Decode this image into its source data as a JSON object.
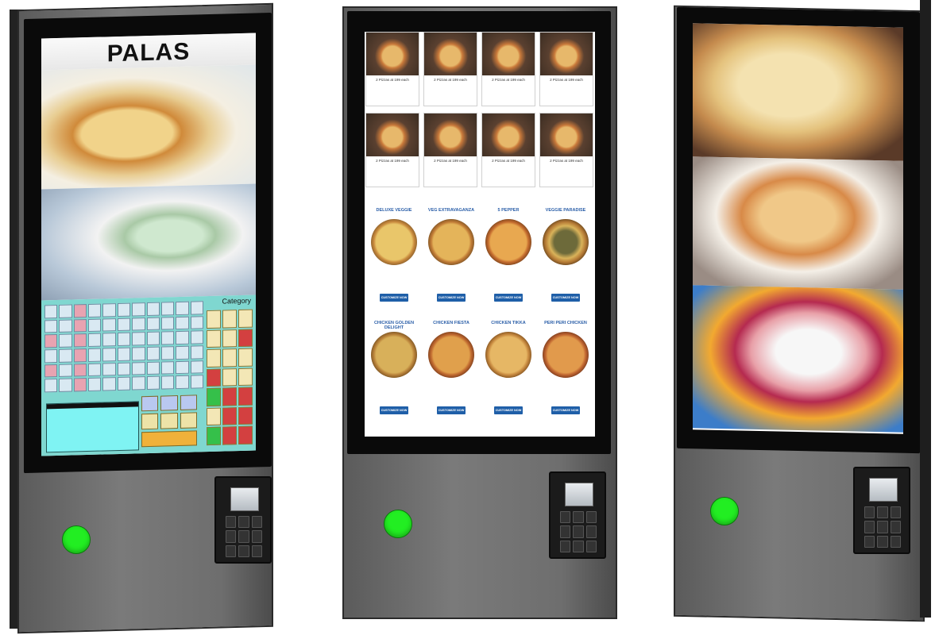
{
  "kiosks": [
    {
      "screen_title": "PALAS",
      "pos": {
        "category_label": "Category"
      }
    },
    {
      "deals": [
        {
          "line1": "2 Pizzas at 199 each"
        },
        {
          "line1": "2 Pizzas at 199 each"
        },
        {
          "line1": "2 Pizzas at 199 each"
        },
        {
          "line1": "2 Pizzas at 199 each"
        },
        {
          "line1": "2 Pizzas at 199 each"
        },
        {
          "line1": "2 Pizzas at 199 each"
        },
        {
          "line1": "2 Pizzas at 199 each"
        },
        {
          "line1": "2 Pizzas at 199 each"
        }
      ],
      "pizzas": [
        {
          "name": "DELUXE VEGGIE",
          "button": "CUSTOMIZE NOW",
          "color": "#d4a63d"
        },
        {
          "name": "VEG EXTRAVAGANZA",
          "button": "CUSTOMIZE NOW",
          "color": "#c9923a"
        },
        {
          "name": "5 PEPPER",
          "button": "CUSTOMIZE NOW",
          "color": "#d08a3a"
        },
        {
          "name": "VEGGIE PARADISE",
          "button": "CUSTOMIZE NOW",
          "color": "#7a6a3a"
        },
        {
          "name": "CHICKEN GOLDEN DELIGHT",
          "button": "CUSTOMIZE NOW",
          "color": "#d6a23a"
        },
        {
          "name": "CHICKEN FIESTA",
          "button": "CUSTOMIZE NOW",
          "color": "#cf7d3a"
        },
        {
          "name": "CHICKEN TIKKA",
          "button": "CUSTOMIZE NOW",
          "color": "#d39a4d"
        },
        {
          "name": "PERI PERI CHICKEN",
          "button": "CUSTOMIZE NOW",
          "color": "#d4823e"
        }
      ]
    },
    {
      "images": [
        "wraps",
        "sausage-rolls",
        "fruit-ice-cream"
      ]
    }
  ]
}
